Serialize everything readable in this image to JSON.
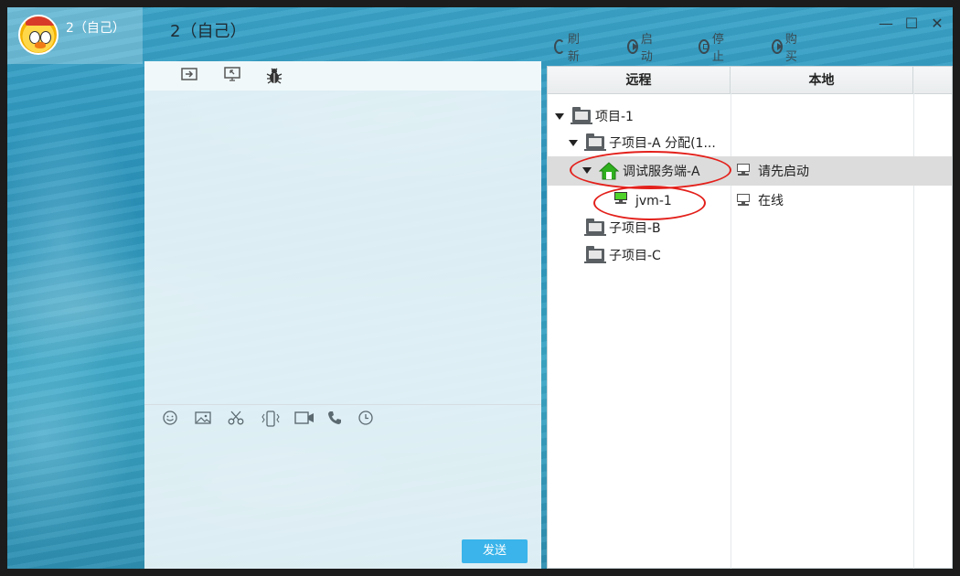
{
  "contact": {
    "name": "2（自己）"
  },
  "window": {
    "title": "2（自己）",
    "minimize": "—",
    "maximize": "☐",
    "close": "✕"
  },
  "actions": [
    {
      "label": "刷新",
      "icon": "refresh-icon"
    },
    {
      "label": "启动",
      "icon": "play-icon"
    },
    {
      "label": "停止",
      "icon": "stop-icon"
    },
    {
      "label": "购买",
      "icon": "play-icon"
    }
  ],
  "chat": {
    "top_toolbar": [
      "send-file-icon",
      "remote-screen-icon",
      "bug-icon"
    ],
    "input_toolbar": [
      "emoji-icon",
      "image-icon",
      "scissors-icon",
      "vibrate-icon",
      "video-call-icon",
      "phone-icon",
      "history-icon"
    ],
    "send_label": "发送"
  },
  "tree": {
    "headers": [
      "远程",
      "本地",
      ""
    ],
    "rows": [
      {
        "label": "项目-1",
        "local": "",
        "type": "folder",
        "level": 0,
        "expanded": true
      },
      {
        "label": "子项目-A 分配(1...",
        "local": "",
        "type": "folder",
        "level": 1,
        "expanded": true
      },
      {
        "label": "调试服务端-A",
        "local": "请先启动",
        "type": "home",
        "level": 2,
        "expanded": true,
        "selected": true
      },
      {
        "label": "jvm-1",
        "local": "在线",
        "type": "pc",
        "level": 3
      },
      {
        "label": "子项目-B",
        "local": "",
        "type": "folder",
        "level": 1
      },
      {
        "label": "子项目-C",
        "local": "",
        "type": "folder",
        "level": 1
      }
    ]
  },
  "colors": {
    "annotation": "#e3201b",
    "send_button": "#3ab4ea",
    "selected_row": "#dcdcdc",
    "online_screen": "#4fd22a"
  }
}
